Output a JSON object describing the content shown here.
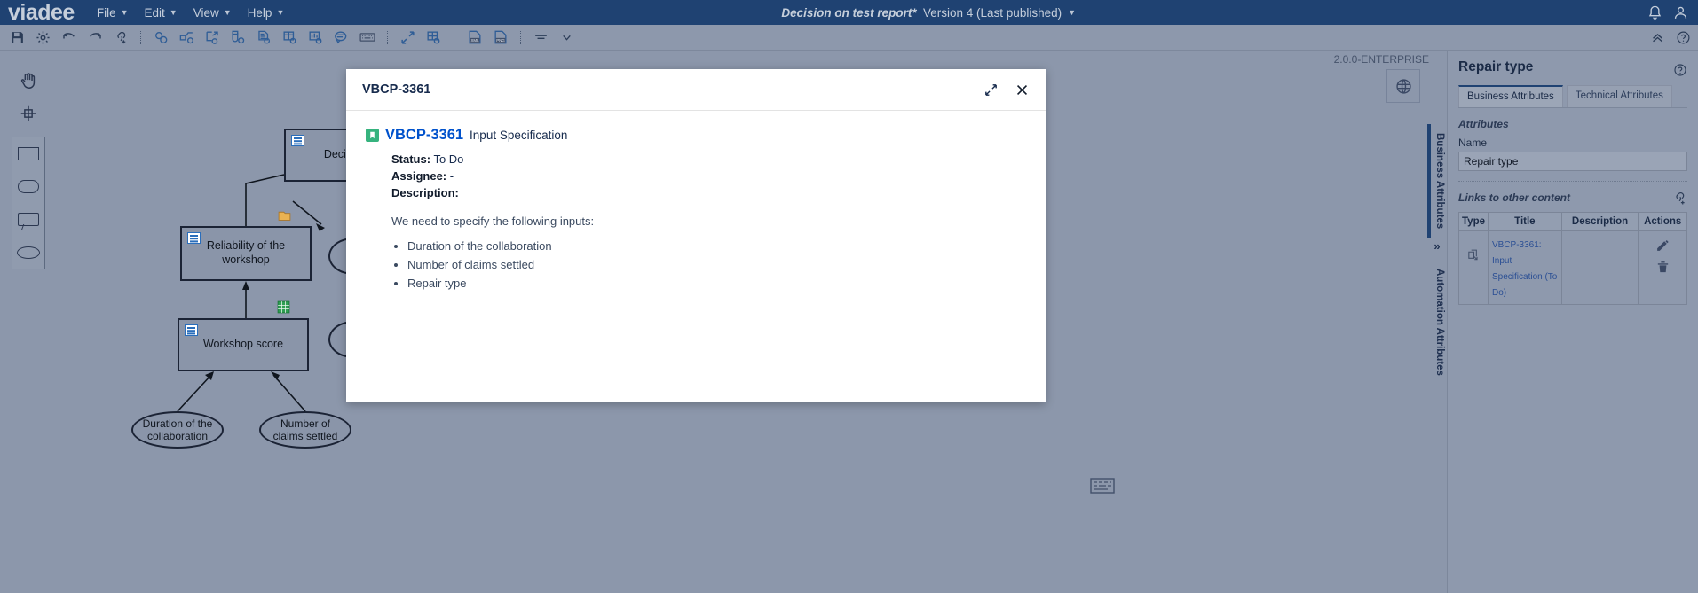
{
  "app": {
    "brand": "viadee",
    "version_tag": "2.0.0-ENTERPRISE"
  },
  "menubar": {
    "items": [
      {
        "label": "File",
        "icon": "chevron-down-icon"
      },
      {
        "label": "Edit",
        "icon": "chevron-down-icon"
      },
      {
        "label": "View",
        "icon": "chevron-down-icon"
      },
      {
        "label": "Help",
        "icon": "chevron-down-icon"
      }
    ],
    "document_title": "Decision on test report*",
    "version_selector": "Version 4 (Last published)",
    "notifications_icon": "bell-icon",
    "account_icon": "user-icon"
  },
  "toolbar": {
    "groups": [
      [
        "save-icon",
        "settings-gear-icon",
        "undo-icon",
        "redo-icon",
        "link-add-icon"
      ],
      [
        "link-pair-icon",
        "share-node-icon",
        "export-box-icon",
        "attach-clip-icon",
        "document-icon",
        "table-grid-icon",
        "chart-bar-icon",
        "comment-icon",
        "keyboard-icon"
      ],
      [
        "fullscreen-arrows-icon",
        "layout-grid-icon"
      ],
      [
        "export-xml-icon",
        "export-png-icon"
      ],
      [
        "align-lines-icon",
        "chevron-down-icon"
      ]
    ],
    "right": [
      "collapse-up-icon",
      "help-circle-icon"
    ]
  },
  "palette": {
    "tools": [
      {
        "name": "hand-pan-tool",
        "icon": "hand-icon"
      },
      {
        "name": "crosshair-select-tool",
        "icon": "crosshair-icon"
      }
    ],
    "shapes": [
      {
        "name": "rectangle-shape",
        "icon": "rectangle-icon"
      },
      {
        "name": "rounded-rectangle-shape",
        "icon": "rounded-rectangle-icon"
      },
      {
        "name": "note-shape",
        "icon": "note-icon"
      },
      {
        "name": "oval-shape",
        "icon": "oval-icon"
      }
    ]
  },
  "diagram": {
    "nodes": [
      {
        "id": "decision",
        "label": "Decision o",
        "type": "decision-node"
      },
      {
        "id": "reliability",
        "label": "Reliability of the workshop",
        "type": "decision-node"
      },
      {
        "id": "workshop_score",
        "label": "Workshop score",
        "type": "decision-node"
      }
    ],
    "inputs": [
      {
        "id": "duration",
        "label": "Duration of the collaboration"
      },
      {
        "id": "claims",
        "label": "Number of claims settled"
      }
    ],
    "markers": [
      {
        "name": "knowledge-source-marker",
        "icon": "folder-tab-icon"
      },
      {
        "name": "spreadsheet-marker",
        "icon": "spreadsheet-icon"
      }
    ]
  },
  "modal": {
    "title": "VBCP-3361",
    "expand_icon": "expand-diagonal-icon",
    "close_icon": "close-icon",
    "issue": {
      "badge_icon": "input-specification-icon",
      "key": "VBCP-3361",
      "type": "Input Specification",
      "status_label": "Status:",
      "status_value": "To Do",
      "assignee_label": "Assignee:",
      "assignee_value": "-",
      "description_label": "Description:",
      "description_intro": "We need to specify the following inputs:",
      "description_items": [
        "Duration of the collaboration",
        "Number of claims settled",
        "Repair type"
      ]
    }
  },
  "globe_button": {
    "icon": "globe-icon"
  },
  "vertical_tabs": [
    {
      "label": "Business Attributes",
      "active": true
    },
    {
      "label": "Automation Attributes",
      "active": false
    }
  ],
  "vertical_tabs_expand": "»",
  "right_panel": {
    "title": "Repair type",
    "help_icon": "help-circle-icon",
    "tabs": [
      {
        "label": "Business Attributes",
        "active": true
      },
      {
        "label": "Technical Attributes",
        "active": false
      }
    ],
    "attributes_section": "Attributes",
    "name_label": "Name",
    "name_value": "Repair type",
    "links_section": "Links to other content",
    "add_link_icon": "link-add-icon",
    "table": {
      "columns": [
        "Type",
        "Title",
        "Description",
        "Actions"
      ],
      "rows": [
        {
          "type_icon": "linked-pages-icon",
          "title": "VBCP-3361: Input Specification (To Do)",
          "description": "",
          "actions": [
            "edit-pencil-icon",
            "delete-trash-icon"
          ]
        }
      ]
    }
  },
  "colors": {
    "header_navy": "#1f4272",
    "canvas_gray": "#8c97ab",
    "link_blue": "#0052CC",
    "badge_green": "#36B37E"
  }
}
